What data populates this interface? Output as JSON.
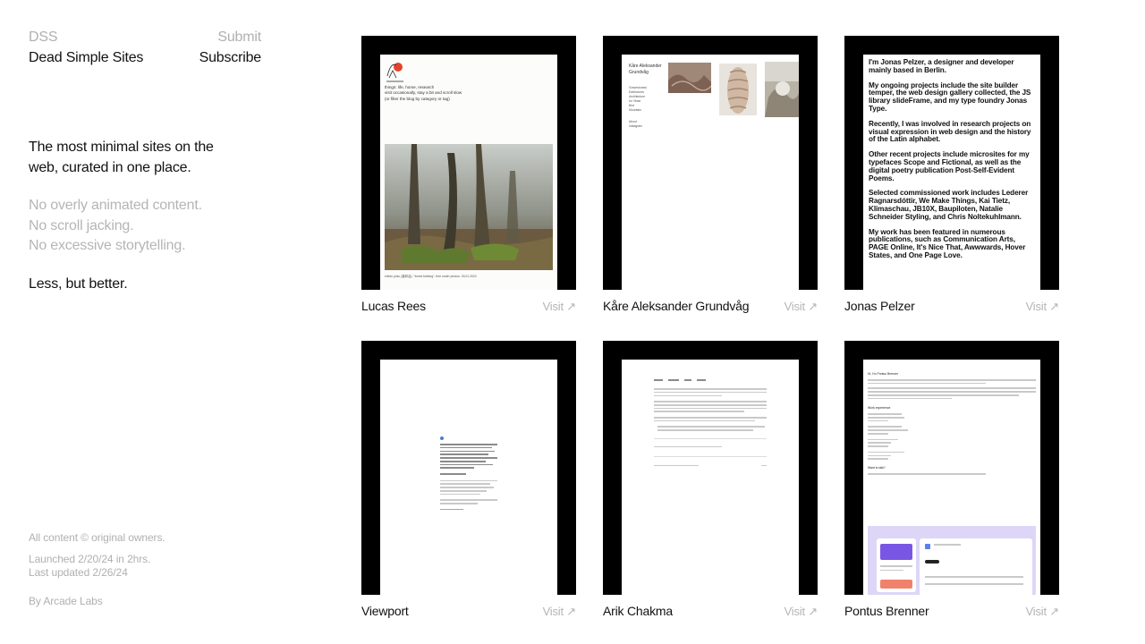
{
  "header": {
    "short_name": "DSS",
    "site_name": "Dead Simple Sites",
    "submit_label": "Submit",
    "subscribe_label": "Subscribe"
  },
  "intro": {
    "headline_line1": "The most minimal sites on the",
    "headline_line2": "web, curated in one place.",
    "points": [
      "No overly animated content.",
      "No scroll jacking.",
      "No excessive storytelling."
    ],
    "tagline": "Less, but better."
  },
  "footer": {
    "rights": "All content © original owners.",
    "launched": "Launched 2/20/24 in 2hrs.",
    "updated": "Last updated 2/26/24",
    "credit": "By Arcade Labs"
  },
  "visit_label": "Visit ↗",
  "sites": [
    {
      "name": "Lucas Rees",
      "preview": {
        "line1": "things: life, home, research",
        "line2": "visit occasionally, stay a bit and scroll slow",
        "line3": "(or filter the blog by category or tag)",
        "caption": "shinto yoku (森林浴), \"forest bathing\". free under photos. 03.01.2024"
      }
    },
    {
      "name": "Kåre Aleksander Grundvåg",
      "preview": {
        "title": "Kåre Aleksander Grundvåg",
        "nav": [
          "Gravestones/",
          "Earthworks",
          "Architecture",
          "for Yeast",
          "Bird",
          "Mountain"
        ],
        "links": [
          "About",
          "Instagram"
        ]
      }
    },
    {
      "name": "Jonas Pelzer",
      "preview": {
        "paragraphs": [
          "I'm Jonas Pelzer, a designer and developer mainly based in Berlin.",
          "My ongoing projects include the site builder temper, the web design gallery collected, the JS library slideFrame, and my type foundry Jonas Type.",
          "Recently, I was involved in research projects on visual expression in web design and the history of the Latin alphabet.",
          "Other recent projects include microsites for my typefaces Scope and Fictional, as well as the digital poetry publication Post-Self-Evident Poems.",
          "Selected commissioned work includes Lederer Ragnarsdóttir, We Make Things, Kai Tietz, Klimaschau, JB10X, Baupiloten, Natalie Schneider Styling, and Chris Noltekuhlmann.",
          "My work has been featured in numerous publications, such as Communication Arts, PAGE Online, It's Nice That, Awwwards, Hover States, and One Page Love."
        ]
      }
    },
    {
      "name": "Viewport"
    },
    {
      "name": "Arik Chakma"
    },
    {
      "name": "Pontus Brenner",
      "preview": {
        "greeting": "Hi, I'm Pontus Brenner",
        "section1": "Work experience",
        "section2": "Want to talk?"
      }
    }
  ]
}
